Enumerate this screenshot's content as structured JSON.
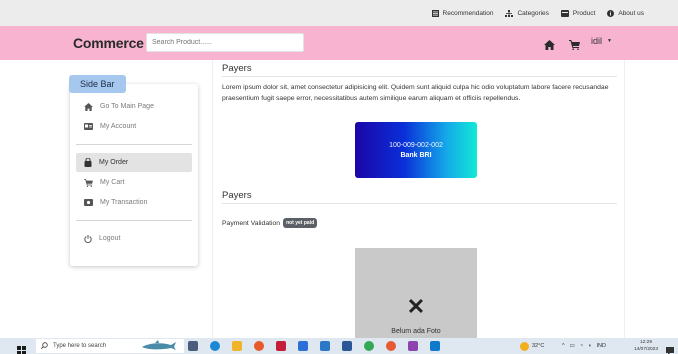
{
  "topnav": {
    "items": [
      {
        "label": "Recommendation",
        "icon": "list-icon"
      },
      {
        "label": "Categories",
        "icon": "sitemap-icon"
      },
      {
        "label": "Product",
        "icon": "product-icon"
      },
      {
        "label": "About us",
        "icon": "info-icon"
      }
    ]
  },
  "header": {
    "brand": "Commerce",
    "search_placeholder": "Search Product......",
    "user": "idil",
    "bg_color": "#f7b3cf"
  },
  "sidebar": {
    "title": "Side Bar",
    "title_bg": "#a6c8ef",
    "items": [
      {
        "label": "Go To Main Page",
        "icon": "home-icon",
        "active": false
      },
      {
        "label": "My Account",
        "icon": "id-card-icon",
        "active": false
      },
      {
        "label": "My Order",
        "icon": "bag-icon",
        "active": true
      },
      {
        "label": "My Cart",
        "icon": "cart-icon",
        "active": false
      },
      {
        "label": "My Transaction",
        "icon": "money-icon",
        "active": false
      },
      {
        "label": "Logout",
        "icon": "power-icon",
        "active": false
      }
    ]
  },
  "main": {
    "payers_title": "Payers",
    "description": "Lorem ipsum dolor sit, amet consectetur adipisicing elit. Quidem sunt aliquid culpa hic odio voluptatum labore facere recusandae praesentium fugit saepe error, necessitatibus autem similique earum aliquam et officiis repellendus.",
    "account_number": "100-009-002-002",
    "bank_name": "Bank BRI",
    "payers_title_2": "Payers",
    "validation_label": "Payment Validation",
    "validation_status": "not yet paid",
    "photo_placeholder": "Belum ada Foto",
    "photo_icon": "x-icon"
  },
  "taskbar": {
    "search_placeholder": "Type here to search",
    "temperature": "32°C",
    "language": "IND",
    "time": "12:29",
    "date": "14/07/2023"
  }
}
